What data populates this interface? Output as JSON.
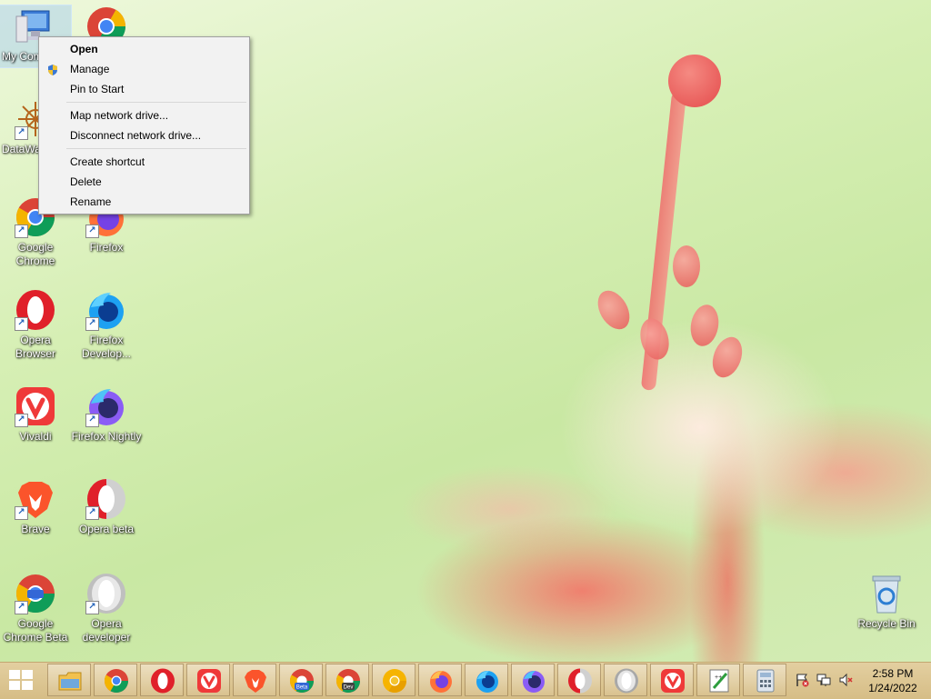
{
  "desktop": {
    "icons": [
      {
        "label": "My Computer",
        "icon": "computer-icon"
      },
      {
        "label": "",
        "icon": "chrome-icon"
      },
      {
        "label": "DataWa",
        "icon": "datawave-icon"
      },
      {
        "label": "Google Chrome",
        "icon": "chrome-icon"
      },
      {
        "label": "Firefox",
        "icon": "firefox-icon"
      },
      {
        "label": "Opera Browser",
        "icon": "opera-icon"
      },
      {
        "label": "Firefox Develop...",
        "icon": "firefox-developer-icon"
      },
      {
        "label": "Vivaldi",
        "icon": "vivaldi-icon"
      },
      {
        "label": "Firefox Nightly",
        "icon": "firefox-nightly-icon"
      },
      {
        "label": "Brave",
        "icon": "brave-icon"
      },
      {
        "label": "Opera beta",
        "icon": "opera-beta-icon"
      },
      {
        "label": "Google Chrome Beta",
        "icon": "chrome-beta-icon"
      },
      {
        "label": "Opera developer",
        "icon": "opera-developer-icon"
      },
      {
        "label": "Recycle Bin",
        "icon": "recycle-bin-icon"
      }
    ],
    "selected_icon_label_visible": "My Com"
  },
  "context_menu": {
    "items": [
      {
        "label": "Open",
        "bold": true
      },
      {
        "label": "Manage",
        "icon": "uac-shield-icon"
      },
      {
        "label": "Pin to Start"
      },
      {
        "label": "Map network drive..."
      },
      {
        "label": "Disconnect network drive..."
      },
      {
        "label": "Create shortcut"
      },
      {
        "label": "Delete"
      },
      {
        "label": "Rename"
      }
    ]
  },
  "taskbar": {
    "start_icon": "windows-logo-icon",
    "pinned": [
      "file-explorer-icon",
      "chrome-icon",
      "opera-icon",
      "vivaldi-icon",
      "brave-icon",
      "chrome-beta-icon",
      "chrome-dev-icon",
      "chrome-canary-icon",
      "firefox-icon",
      "firefox-developer-icon",
      "firefox-nightly-icon",
      "opera-beta-icon",
      "opera-developer-icon",
      "vivaldi-snapshot-icon",
      "notepad-plus-icon",
      "calculator-icon"
    ],
    "chrome_beta_badge": "Beta",
    "chrome_dev_badge": "Dev",
    "tray": [
      "action-center-flag-icon",
      "network-icon",
      "volume-muted-icon"
    ],
    "clock": {
      "time": "2:58 PM",
      "date": "1/24/2022"
    }
  },
  "colors": {
    "taskbar": "#d9c28f",
    "menu_bg": "#f2f2f2",
    "chrome_red": "#db4437",
    "opera_red": "#e0202a",
    "vivaldi_red": "#ef3939",
    "brave_orange": "#fb542b"
  }
}
